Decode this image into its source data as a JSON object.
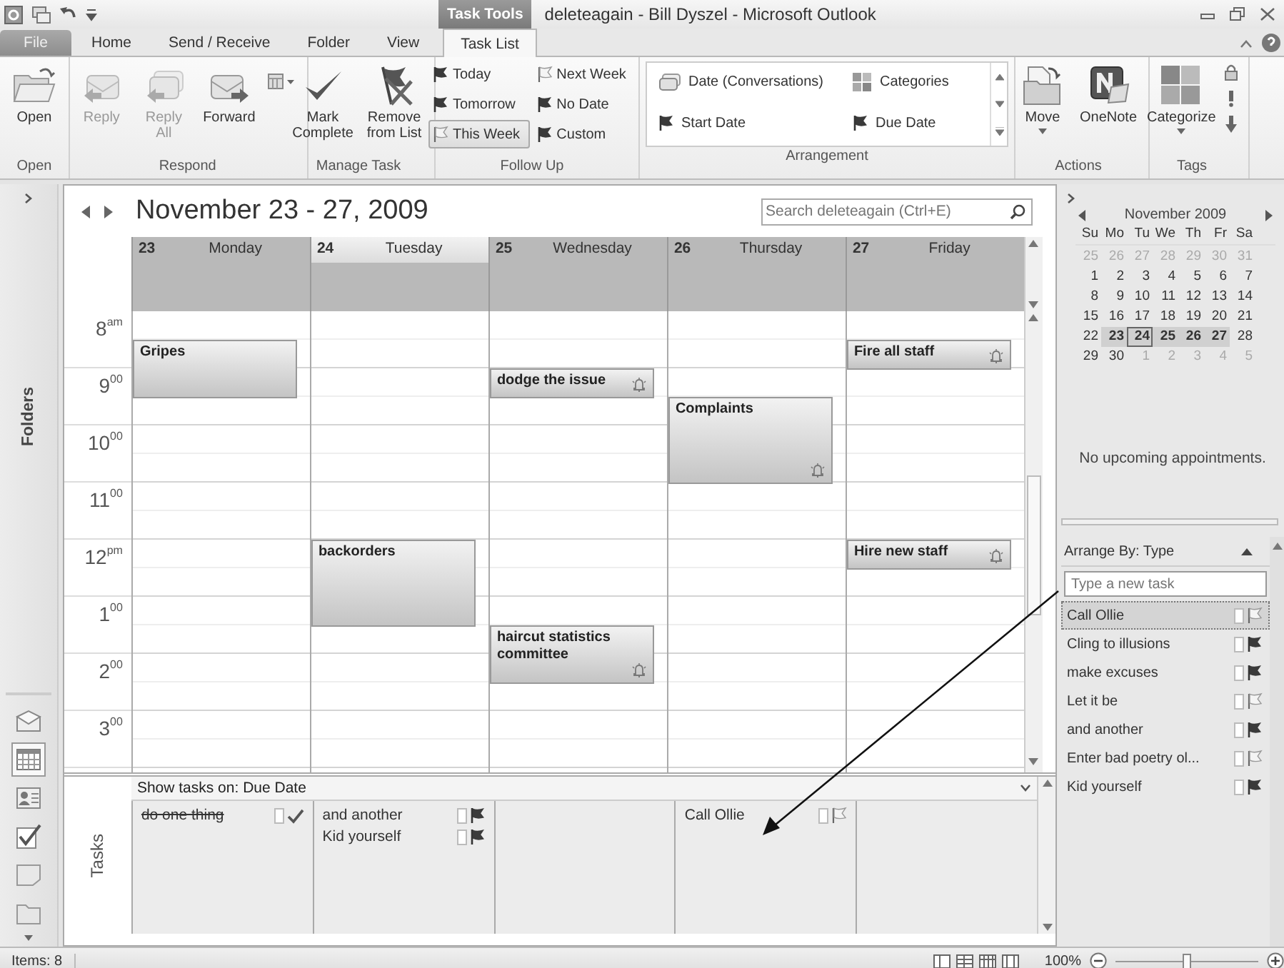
{
  "title_bar": {
    "context_label": "Task Tools",
    "title": "deleteagain - Bill Dyszel - Microsoft Outlook"
  },
  "tabs": [
    {
      "label": "File",
      "kind": "file",
      "selected": false
    },
    {
      "label": "Home",
      "kind": "tab",
      "selected": false
    },
    {
      "label": "Send / Receive",
      "kind": "tab",
      "selected": false
    },
    {
      "label": "Folder",
      "kind": "tab",
      "selected": false
    },
    {
      "label": "View",
      "kind": "tab",
      "selected": false
    },
    {
      "label": "Task List",
      "kind": "tab",
      "selected": true
    }
  ],
  "ribbon": {
    "groups": [
      {
        "label": "Open",
        "kind": "buttons",
        "items": [
          {
            "label": "Open",
            "kind": "large",
            "disabled": false
          }
        ]
      },
      {
        "label": "Respond",
        "kind": "buttons",
        "items": [
          {
            "label": "Reply",
            "kind": "large",
            "disabled": true
          },
          {
            "label": "Reply All",
            "kind": "large",
            "disabled": true
          },
          {
            "label": "Forward",
            "kind": "large",
            "disabled": false
          },
          {
            "kind": "menu"
          }
        ]
      },
      {
        "label": "Manage Task",
        "kind": "buttons",
        "items": [
          {
            "label": "Mark Complete",
            "kind": "large",
            "disabled": false
          },
          {
            "label": "Remove from List",
            "kind": "large",
            "disabled": false
          }
        ]
      },
      {
        "label": "Follow Up",
        "kind": "flags",
        "items": [
          {
            "label": "Today",
            "kind": "dark",
            "selected": false
          },
          {
            "label": "Next Week",
            "kind": "light",
            "selected": false
          },
          {
            "label": "Tomorrow",
            "kind": "dark",
            "selected": false
          },
          {
            "label": "No Date",
            "kind": "dark",
            "selected": false
          },
          {
            "label": "This Week",
            "kind": "light",
            "selected": true
          },
          {
            "label": "Custom",
            "kind": "dark",
            "selected": false
          }
        ]
      },
      {
        "label": "Arrangement",
        "kind": "gallery",
        "items": [
          {
            "label": "Date (Conversations)"
          },
          {
            "label": "Categories"
          },
          {
            "label": "Start Date"
          },
          {
            "label": "Due Date"
          }
        ]
      },
      {
        "label": "Actions",
        "kind": "buttons",
        "items": [
          {
            "label": "Move",
            "kind": "large-menu",
            "disabled": false
          },
          {
            "label": "OneNote",
            "kind": "large",
            "disabled": false
          }
        ]
      },
      {
        "label": "Tags",
        "kind": "buttons",
        "items": [
          {
            "label": "Categorize",
            "kind": "large-menu",
            "disabled": false
          },
          {
            "kind": "stack"
          }
        ]
      }
    ]
  },
  "nav_pane": {
    "label": "Folders",
    "modules": [
      {
        "selected": false
      },
      {
        "selected": true
      },
      {
        "selected": false
      },
      {
        "selected": false
      },
      {
        "selected": false
      },
      {
        "selected": false
      }
    ]
  },
  "calendar": {
    "title": "November 23 - 27, 2009",
    "search": {
      "placeholder": "Search deleteagain (Ctrl+E)"
    },
    "hours": [
      "8$^{am}$",
      "9$^{00}$",
      "10$^{00}$",
      "11$^{00}$",
      "12$^{pm}$",
      "1$^{00}$",
      "2$^{00}$",
      "3$^{00}$"
    ],
    "days": [
      {
        "number": "23",
        "name": "Monday",
        "today": false,
        "slots": [
          {
            "kind": "free"
          },
          {
            "kind": "start",
            "title": "Gripes",
            "reminder": false
          },
          {
            "kind": "cont"
          },
          {
            "kind": "free"
          },
          {
            "kind": "free"
          },
          {
            "kind": "free"
          },
          {
            "kind": "free"
          },
          {
            "kind": "free"
          },
          {
            "kind": "free"
          },
          {
            "kind": "free"
          },
          {
            "kind": "free"
          },
          {
            "kind": "free"
          },
          {
            "kind": "free"
          },
          {
            "kind": "free"
          },
          {
            "kind": "free"
          },
          {
            "kind": "free"
          }
        ],
        "tasks": [
          {
            "name": "do one thing",
            "completed": true,
            "kind": "done"
          }
        ]
      },
      {
        "number": "24",
        "name": "Tuesday",
        "today": true,
        "slots": [
          {
            "kind": "free"
          },
          {
            "kind": "free"
          },
          {
            "kind": "free"
          },
          {
            "kind": "free"
          },
          {
            "kind": "free"
          },
          {
            "kind": "free"
          },
          {
            "kind": "free"
          },
          {
            "kind": "free"
          },
          {
            "kind": "start",
            "title": "backorders",
            "reminder": false
          },
          {
            "kind": "cont"
          },
          {
            "kind": "cont"
          },
          {
            "kind": "free"
          },
          {
            "kind": "free"
          },
          {
            "kind": "free"
          },
          {
            "kind": "free"
          },
          {
            "kind": "free"
          }
        ],
        "tasks": [
          {
            "name": "and another",
            "completed": false,
            "kind": "dark"
          },
          {
            "name": "Kid yourself",
            "completed": false,
            "kind": "dark"
          }
        ]
      },
      {
        "number": "25",
        "name": "Wednesday",
        "today": false,
        "slots": [
          {
            "kind": "free"
          },
          {
            "kind": "free"
          },
          {
            "kind": "start",
            "title": "dodge the issue",
            "reminder": true
          },
          {
            "kind": "free"
          },
          {
            "kind": "free"
          },
          {
            "kind": "free"
          },
          {
            "kind": "free"
          },
          {
            "kind": "free"
          },
          {
            "kind": "free"
          },
          {
            "kind": "free"
          },
          {
            "kind": "free"
          },
          {
            "kind": "start",
            "title": "haircut statistics committee",
            "reminder": true
          },
          {
            "kind": "cont"
          },
          {
            "kind": "free"
          },
          {
            "kind": "free"
          },
          {
            "kind": "free"
          }
        ]
      },
      {
        "number": "26",
        "name": "Thursday",
        "today": false,
        "slots": [
          {
            "kind": "free"
          },
          {
            "kind": "free"
          },
          {
            "kind": "free"
          },
          {
            "kind": "start",
            "title": "Complaints",
            "reminder": true
          },
          {
            "kind": "cont"
          },
          {
            "kind": "cont"
          },
          {
            "kind": "free"
          },
          {
            "kind": "free"
          },
          {
            "kind": "free"
          },
          {
            "kind": "free"
          },
          {
            "kind": "free"
          },
          {
            "kind": "free"
          },
          {
            "kind": "free"
          },
          {
            "kind": "free"
          },
          {
            "kind": "free"
          },
          {
            "kind": "free"
          }
        ],
        "tasks": [
          {
            "name": "Call Ollie",
            "completed": false,
            "kind": "light"
          }
        ]
      },
      {
        "number": "27",
        "name": "Friday",
        "today": false,
        "slots": [
          {
            "kind": "free"
          },
          {
            "kind": "start",
            "title": "Fire all staff",
            "reminder": true
          },
          {
            "kind": "free"
          },
          {
            "kind": "free"
          },
          {
            "kind": "free"
          },
          {
            "kind": "free"
          },
          {
            "kind": "free"
          },
          {
            "kind": "free"
          },
          {
            "kind": "start",
            "title": "Hire new staff",
            "reminder": true
          },
          {
            "kind": "free"
          },
          {
            "kind": "free"
          },
          {
            "kind": "free"
          },
          {
            "kind": "free"
          },
          {
            "kind": "free"
          },
          {
            "kind": "free"
          },
          {
            "kind": "free"
          }
        ]
      }
    ]
  },
  "tasks_pane": {
    "label": "Tasks",
    "header": "Show tasks on: Due Date"
  },
  "todo_bar": {
    "month": "November 2009",
    "weekdays": [
      "Su",
      "Mo",
      "Tu",
      "We",
      "Th",
      "Fr",
      "Sa"
    ],
    "weeks": [
      [
        {
          "d": "25",
          "outside": true,
          "selected": false,
          "today": false
        },
        {
          "d": "26",
          "outside": true,
          "selected": false,
          "today": false
        },
        {
          "d": "27",
          "outside": true,
          "selected": false,
          "today": false
        },
        {
          "d": "28",
          "outside": true,
          "selected": false,
          "today": false
        },
        {
          "d": "29",
          "outside": true,
          "selected": false,
          "today": false
        },
        {
          "d": "30",
          "outside": true,
          "selected": false,
          "today": false
        },
        {
          "d": "31",
          "outside": true,
          "selected": false,
          "today": false
        }
      ],
      [
        {
          "d": "1",
          "outside": false,
          "selected": false,
          "today": false
        },
        {
          "d": "2",
          "outside": false,
          "selected": false,
          "today": false
        },
        {
          "d": "3",
          "outside": false,
          "selected": false,
          "today": false
        },
        {
          "d": "4",
          "outside": false,
          "selected": false,
          "today": false
        },
        {
          "d": "5",
          "outside": false,
          "selected": false,
          "today": false
        },
        {
          "d": "6",
          "outside": false,
          "selected": false,
          "today": false
        },
        {
          "d": "7",
          "outside": false,
          "selected": false,
          "today": false
        }
      ],
      [
        {
          "d": "8",
          "outside": false,
          "selected": false,
          "today": false
        },
        {
          "d": "9",
          "outside": false,
          "selected": false,
          "today": false
        },
        {
          "d": "10",
          "outside": false,
          "selected": false,
          "today": false
        },
        {
          "d": "11",
          "outside": false,
          "selected": false,
          "today": false
        },
        {
          "d": "12",
          "outside": false,
          "selected": false,
          "today": false
        },
        {
          "d": "13",
          "outside": false,
          "selected": false,
          "today": false
        },
        {
          "d": "14",
          "outside": false,
          "selected": false,
          "today": false
        }
      ],
      [
        {
          "d": "15",
          "outside": false,
          "selected": false,
          "today": false
        },
        {
          "d": "16",
          "outside": false,
          "selected": false,
          "today": false
        },
        {
          "d": "17",
          "outside": false,
          "selected": false,
          "today": false
        },
        {
          "d": "18",
          "outside": false,
          "selected": false,
          "today": false
        },
        {
          "d": "19",
          "outside": false,
          "selected": false,
          "today": false
        },
        {
          "d": "20",
          "outside": false,
          "selected": false,
          "today": false
        },
        {
          "d": "21",
          "outside": false,
          "selected": false,
          "today": false
        }
      ],
      [
        {
          "d": "22",
          "outside": false,
          "selected": false,
          "today": false
        },
        {
          "d": "23",
          "outside": false,
          "selected": true,
          "today": false
        },
        {
          "d": "24",
          "outside": false,
          "selected": true,
          "today": true
        },
        {
          "d": "25",
          "outside": false,
          "selected": true,
          "today": false
        },
        {
          "d": "26",
          "outside": false,
          "selected": true,
          "today": false
        },
        {
          "d": "27",
          "outside": false,
          "selected": true,
          "today": false
        },
        {
          "d": "28",
          "outside": false,
          "selected": false,
          "today": false
        }
      ],
      [
        {
          "d": "29",
          "outside": false,
          "selected": false,
          "today": false
        },
        {
          "d": "30",
          "outside": false,
          "selected": false,
          "today": false
        },
        {
          "d": "1",
          "outside": true,
          "selected": false,
          "today": false
        },
        {
          "d": "2",
          "outside": true,
          "selected": false,
          "today": false
        },
        {
          "d": "3",
          "outside": true,
          "selected": false,
          "today": false
        },
        {
          "d": "4",
          "outside": true,
          "selected": false,
          "today": false
        },
        {
          "d": "5",
          "outside": true,
          "selected": false,
          "today": false
        }
      ]
    ],
    "no_appointments": "No upcoming appointments.",
    "arrange_by": "Arrange By: Type",
    "new_task": {
      "placeholder": "Type a new task"
    },
    "tasks": [
      {
        "name": "Call Ollie",
        "selected": true,
        "kind": "light"
      },
      {
        "name": "Cling to illusions",
        "selected": false,
        "kind": "dark"
      },
      {
        "name": "make excuses",
        "selected": false,
        "kind": "dark"
      },
      {
        "name": "Let it be",
        "selected": false,
        "kind": "light"
      },
      {
        "name": "and another",
        "selected": false,
        "kind": "dark"
      },
      {
        "name": "Enter bad poetry ol...",
        "selected": false,
        "kind": "light"
      },
      {
        "name": "Kid yourself",
        "selected": false,
        "kind": "dark"
      }
    ]
  },
  "status_bar": {
    "items": "Items: 8",
    "zoom": "100%",
    "zoom_slider": {
      "level": 0.5
    }
  }
}
